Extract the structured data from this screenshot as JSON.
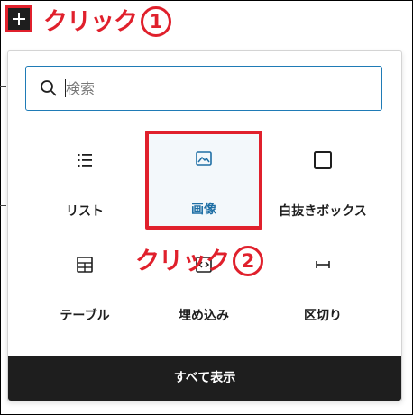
{
  "annotations": {
    "step1_text": "クリック",
    "step1_num": "1",
    "step2_text": "クリック",
    "step2_num": "2"
  },
  "search": {
    "placeholder": "検索"
  },
  "blocks": [
    {
      "label": "リスト",
      "icon": "list-icon"
    },
    {
      "label": "画像",
      "icon": "image-icon"
    },
    {
      "label": "白抜きボックス",
      "icon": "square-icon"
    },
    {
      "label": "テーブル",
      "icon": "table-icon"
    },
    {
      "label": "埋め込み",
      "icon": "embed-icon"
    },
    {
      "label": "区切り",
      "icon": "separator-icon"
    }
  ],
  "show_all_label": "すべて表示",
  "colors": {
    "accent": "#1f7bb6",
    "highlight": "#e0202c",
    "dark": "#1e1e1e"
  }
}
